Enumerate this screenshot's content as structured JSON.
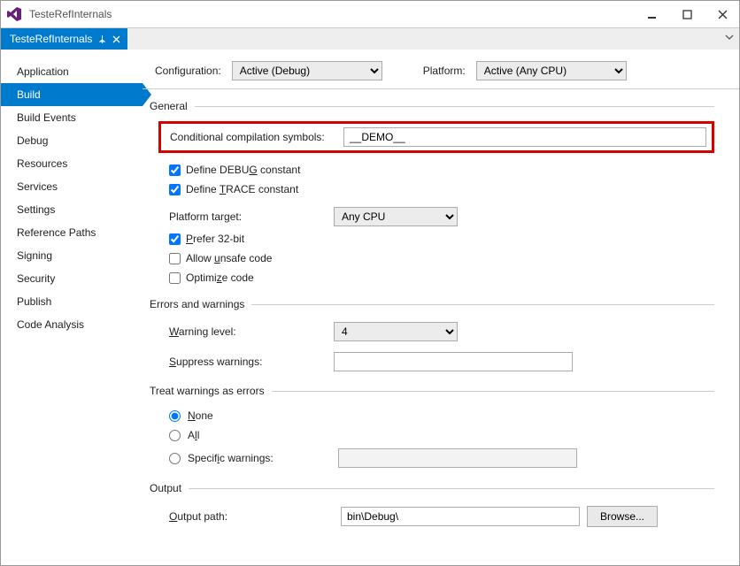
{
  "window": {
    "title": "TesteRefInternals"
  },
  "tab": {
    "label": "TesteRefInternals"
  },
  "toolbar": {
    "config_label": "Configuration:",
    "config_value": "Active (Debug)",
    "platform_label": "Platform:",
    "platform_value": "Active (Any CPU)"
  },
  "sidebar": {
    "items": [
      "Application",
      "Build",
      "Build Events",
      "Debug",
      "Resources",
      "Services",
      "Settings",
      "Reference Paths",
      "Signing",
      "Security",
      "Publish",
      "Code Analysis"
    ],
    "active_index": 1
  },
  "general": {
    "section": "General",
    "cond_label": "Conditional compilation symbols:",
    "cond_value": "__DEMO__",
    "debug_const": "Define DEBUG constant",
    "trace_const": "Define TRACE constant",
    "platform_target_label": "Platform target:",
    "platform_target_value": "Any CPU",
    "prefer32": "Prefer 32-bit",
    "unsafe": "Allow unsafe code",
    "optimize": "Optimize code"
  },
  "errors": {
    "section": "Errors and warnings",
    "warn_level_label": "Warning level:",
    "warn_level_value": "4",
    "suppress_label": "Suppress warnings:",
    "suppress_value": ""
  },
  "treat": {
    "section": "Treat warnings as errors",
    "none": "None",
    "all": "All",
    "specific": "Specific warnings:",
    "specific_value": ""
  },
  "output": {
    "section": "Output",
    "path_label": "Output path:",
    "path_value": "bin\\Debug\\",
    "browse": "Browse..."
  }
}
